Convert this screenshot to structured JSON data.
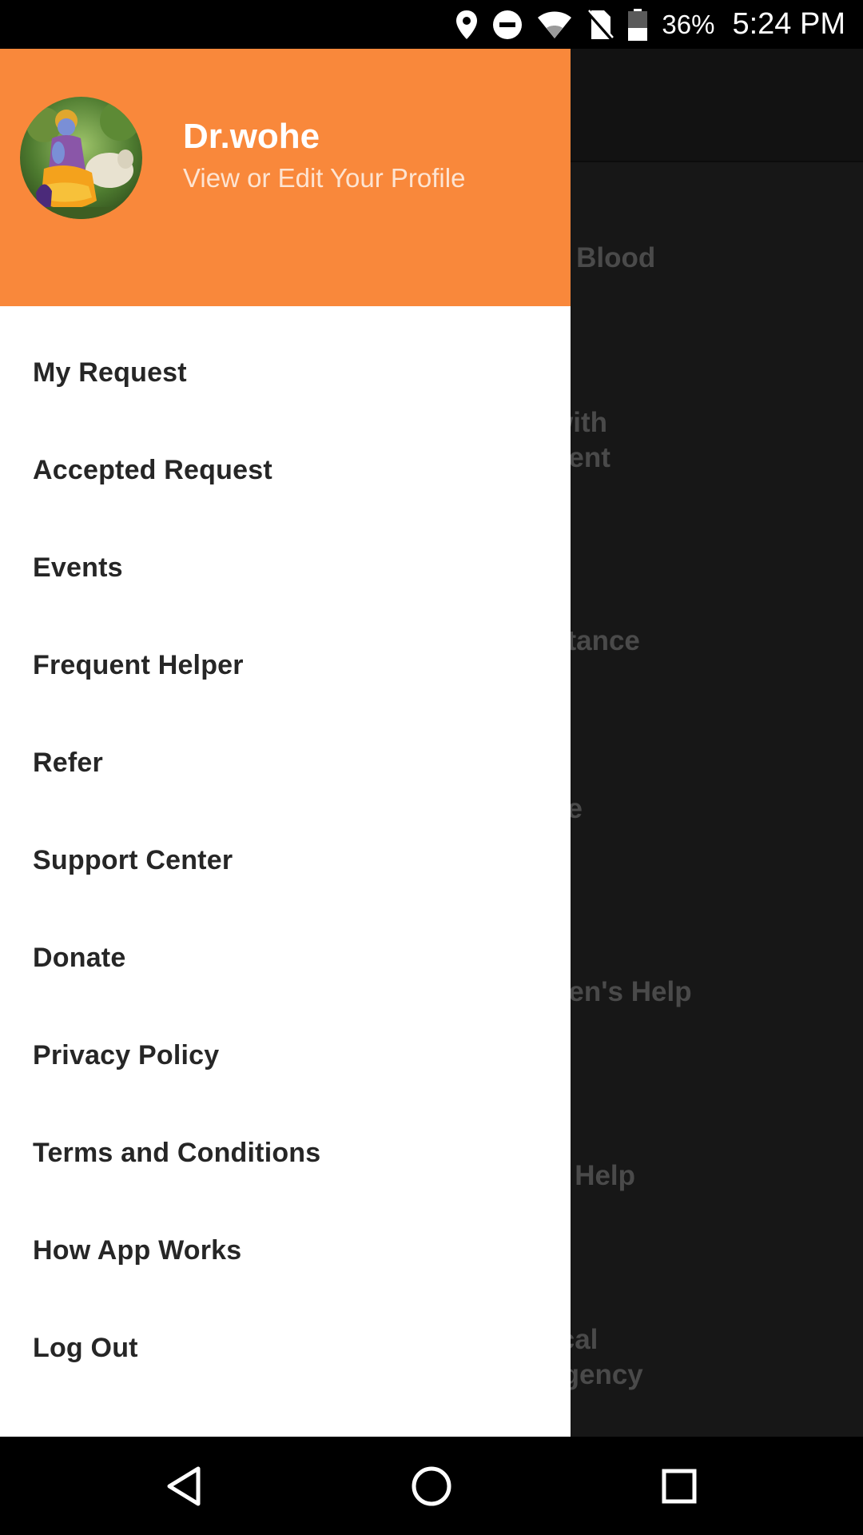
{
  "status_bar": {
    "battery_percent": "36%",
    "time": "5:24 PM",
    "icons": [
      "location-icon",
      "do-not-disturb-icon",
      "wifi-icon",
      "no-sim-icon",
      "battery-icon"
    ]
  },
  "background_app": {
    "labels": [
      "d Blood",
      "with\ndent",
      "d\nstance",
      "ce",
      "nen's Help",
      "c Help",
      "ical\nrgency"
    ]
  },
  "drawer": {
    "header": {
      "name": "Dr.wohe",
      "subtitle": "View or Edit Your Profile",
      "background_color": "#f9883b"
    },
    "menu": [
      {
        "label": "My Request"
      },
      {
        "label": "Accepted Request"
      },
      {
        "label": "Events"
      },
      {
        "label": "Frequent Helper"
      },
      {
        "label": "Refer"
      },
      {
        "label": "Support Center"
      },
      {
        "label": "Donate"
      },
      {
        "label": "Privacy Policy"
      },
      {
        "label": "Terms and Conditions"
      },
      {
        "label": "How App Works"
      },
      {
        "label": "Log Out"
      }
    ]
  },
  "nav_bar": {
    "buttons": [
      "back-icon",
      "home-icon",
      "recents-icon"
    ]
  }
}
